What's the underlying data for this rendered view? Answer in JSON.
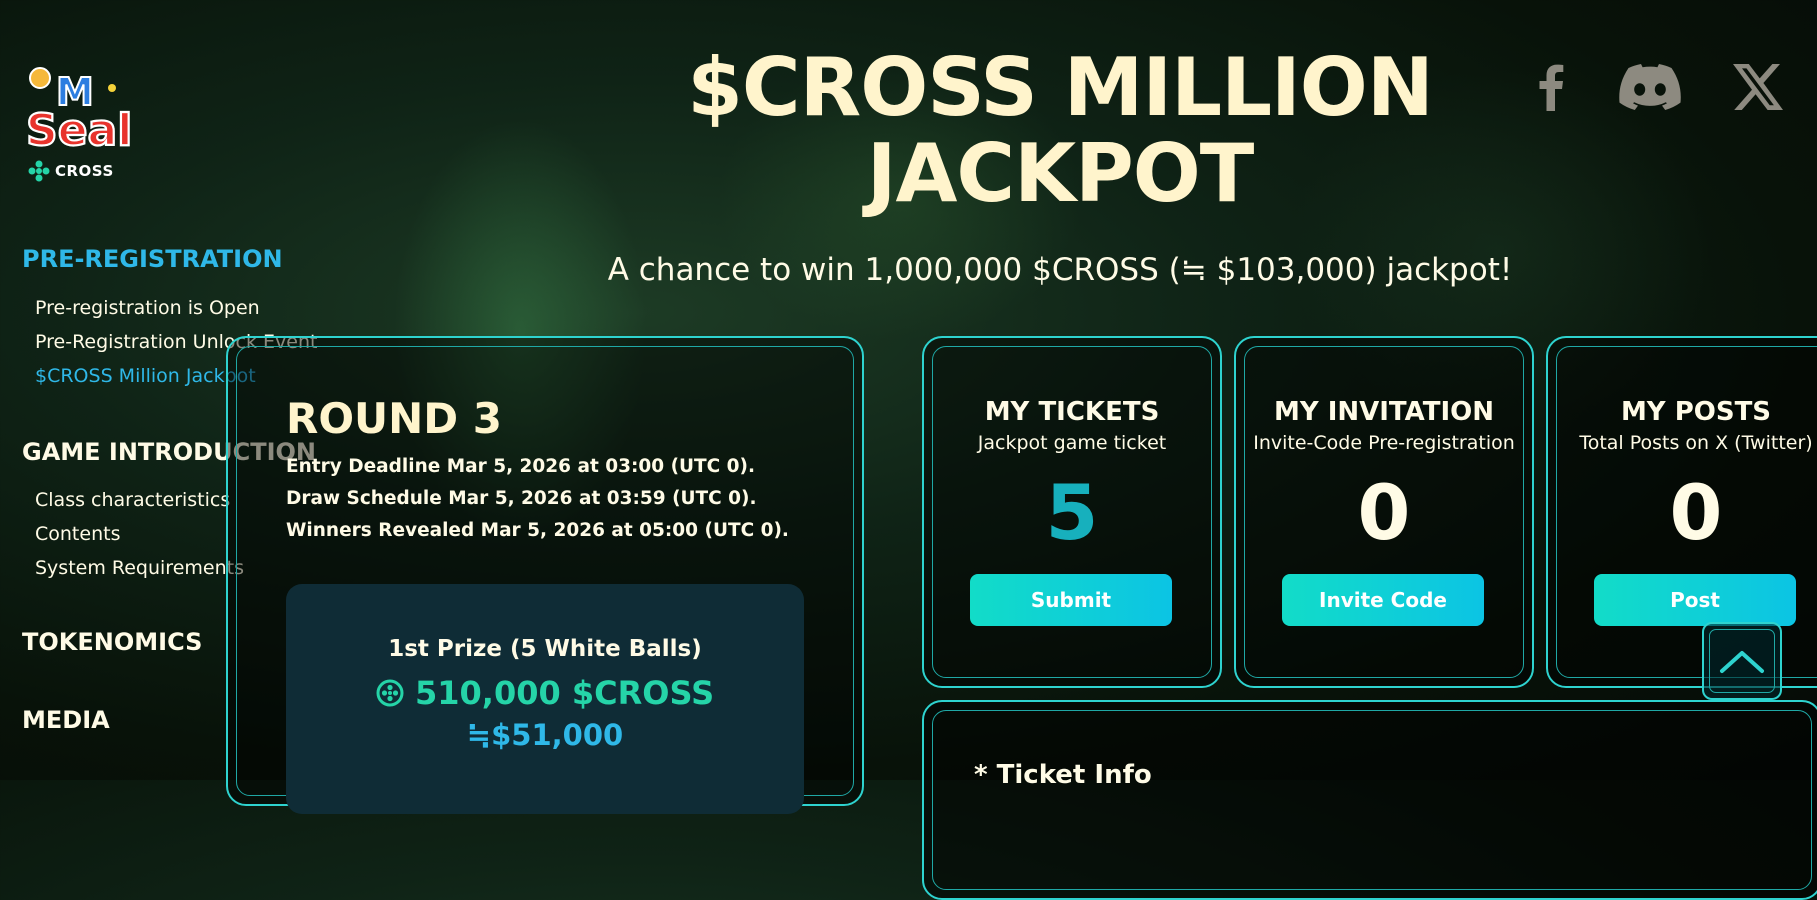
{
  "brand": {
    "logo_text": "MSeal",
    "sub_brand": "CROSS"
  },
  "sidebar": {
    "sections": [
      {
        "label": "PRE-REGISTRATION",
        "active": true,
        "items": [
          {
            "label": "Pre-registration is Open",
            "active": false
          },
          {
            "label": "Pre-Registration Unlock Event",
            "active": false
          },
          {
            "label": "$CROSS Million Jackpot",
            "active": true
          }
        ]
      },
      {
        "label": "GAME INTRODUCTION",
        "active": false,
        "items": [
          {
            "label": "Class characteristics",
            "active": false
          },
          {
            "label": "Contents",
            "active": false
          },
          {
            "label": "System Requirements",
            "active": false
          }
        ]
      },
      {
        "label": "TOKENOMICS",
        "active": false,
        "items": []
      },
      {
        "label": "MEDIA",
        "active": false,
        "items": []
      }
    ]
  },
  "hero": {
    "title_line1": "$CROSS MILLION",
    "title_line2": "JACKPOT",
    "subtitle": "A chance to win 1,000,000 $CROSS (≒ $103,000) jackpot!"
  },
  "social": [
    {
      "icon": "facebook-icon"
    },
    {
      "icon": "discord-icon"
    },
    {
      "icon": "x-twitter-icon"
    }
  ],
  "round": {
    "title": "ROUND 3",
    "lines": [
      "Entry Deadline Mar 5, 2026 at 03:00 (UTC 0).",
      "Draw Schedule Mar 5, 2026 at 03:59 (UTC 0).",
      "Winners Revealed Mar 5, 2026 at 05:00 (UTC 0)."
    ],
    "prize": {
      "label": "1st Prize (5 White Balls)",
      "amount": "510,000 $CROSS",
      "usd": "≒$51,000"
    }
  },
  "stats": [
    {
      "title": "MY TICKETS",
      "desc": "Jackpot game ticket",
      "value": "5",
      "button": "Submit"
    },
    {
      "title": "MY INVITATION",
      "desc": "Invite-Code Pre-registration",
      "value": "0",
      "button": "Invite Code"
    },
    {
      "title": "MY POSTS",
      "desc": "Total Posts on X (Twitter)",
      "value": "0",
      "button": "Post"
    }
  ],
  "ticket_info": {
    "title": "* Ticket Info"
  },
  "colors": {
    "accent": "#2ed3cf",
    "highlight": "#2fb8e8",
    "cream": "#fff4cc",
    "prize_green": "#25d4a8"
  }
}
